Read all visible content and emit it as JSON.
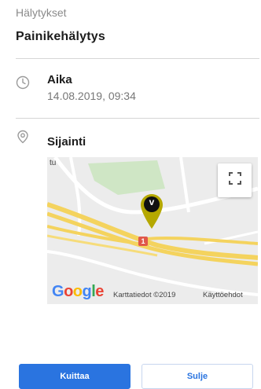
{
  "header": {
    "breadcrumb": "Hälytykset",
    "title": "Painikehälytys"
  },
  "time_section": {
    "icon": "clock-icon",
    "label": "Aika",
    "value": "14.08.2019, 09:34"
  },
  "location_section": {
    "icon": "location-pin-icon",
    "label": "Sijainti"
  },
  "map": {
    "corner_label": "tu",
    "road_badge": "1",
    "marker_glyph": "v",
    "marker_color": "#b5a800",
    "brand_logo": "Google",
    "attribution": "Karttatiedot ©2019",
    "terms": "Käyttöehdot"
  },
  "actions": {
    "primary_label": "Kuittaa",
    "secondary_label": "Sulje"
  },
  "colors": {
    "accent": "#2a74e0",
    "map_road_yellow": "#f4d35e",
    "park_green": "#cfe6c5"
  }
}
